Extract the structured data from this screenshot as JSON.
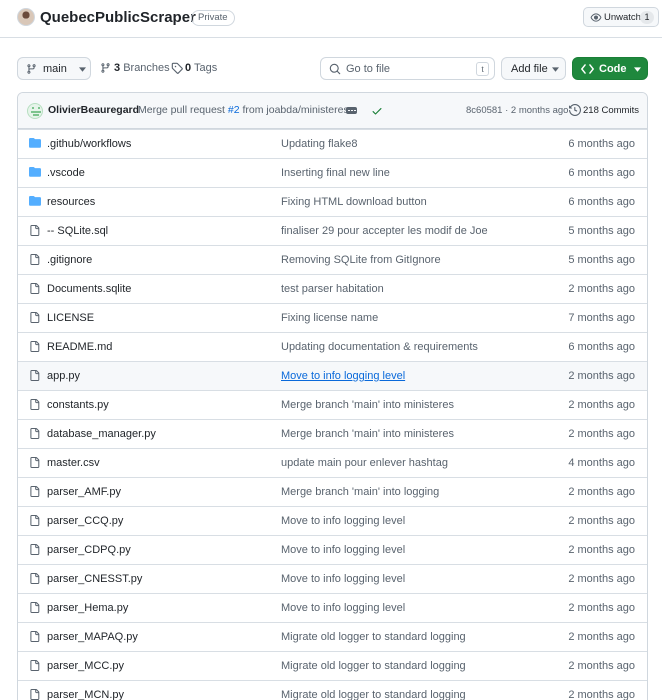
{
  "repo": {
    "name": "QuebecPublicScraper",
    "visibility": "Private",
    "watch_label": "Unwatch",
    "watch_count": "1"
  },
  "toolbar": {
    "branch": "main",
    "branches_count": "3",
    "branches_label": "Branches",
    "tags_count": "0",
    "tags_label": "Tags",
    "goto_placeholder": "Go to file",
    "goto_shortcut": "t",
    "add_file_label": "Add file",
    "code_label": "Code"
  },
  "commit": {
    "author": "OlivierBeauregard",
    "message_prefix": "Merge pull request",
    "pr_number": "#2",
    "message_suffix": "from joabda/ministeres",
    "hash_age": "8c60581 · 2 months ago",
    "commits_label": "218 Commits"
  },
  "colors": {
    "accent_green": "#1f883d",
    "link_blue": "#0969da",
    "folder_blue": "#54aeff",
    "muted": "#59636e"
  },
  "files": [
    {
      "name": ".github/workflows",
      "type": "folder",
      "message": "Updating flake8",
      "age": "6 months ago"
    },
    {
      "name": ".vscode",
      "type": "folder",
      "message": "Inserting final new line",
      "age": "6 months ago"
    },
    {
      "name": "resources",
      "type": "folder",
      "message": "Fixing HTML download button",
      "age": "6 months ago"
    },
    {
      "name": "-- SQLite.sql",
      "type": "file",
      "message": "finaliser 29 pour accepter les modif de Joe",
      "age": "5 months ago"
    },
    {
      "name": ".gitignore",
      "type": "file",
      "message": "Removing SQLite from GitIgnore",
      "age": "5 months ago"
    },
    {
      "name": "Documents.sqlite",
      "type": "file",
      "message": "test parser habitation",
      "age": "2 months ago"
    },
    {
      "name": "LICENSE",
      "type": "file",
      "message": "Fixing license name",
      "age": "7 months ago"
    },
    {
      "name": "README.md",
      "type": "file",
      "message": "Updating documentation & requirements",
      "age": "6 months ago"
    },
    {
      "name": "app.py",
      "type": "file",
      "message": "Move to info logging level",
      "age": "2 months ago",
      "hover": true
    },
    {
      "name": "constants.py",
      "type": "file",
      "message": "Merge branch 'main' into ministeres",
      "age": "2 months ago"
    },
    {
      "name": "database_manager.py",
      "type": "file",
      "message": "Merge branch 'main' into ministeres",
      "age": "2 months ago"
    },
    {
      "name": "master.csv",
      "type": "file",
      "message": "update main pour enlever hashtag",
      "age": "4 months ago"
    },
    {
      "name": "parser_AMF.py",
      "type": "file",
      "message": "Merge branch 'main' into logging",
      "age": "2 months ago"
    },
    {
      "name": "parser_CCQ.py",
      "type": "file",
      "message": "Move to info logging level",
      "age": "2 months ago"
    },
    {
      "name": "parser_CDPQ.py",
      "type": "file",
      "message": "Move to info logging level",
      "age": "2 months ago"
    },
    {
      "name": "parser_CNESST.py",
      "type": "file",
      "message": "Move to info logging level",
      "age": "2 months ago"
    },
    {
      "name": "parser_Hema.py",
      "type": "file",
      "message": "Move to info logging level",
      "age": "2 months ago"
    },
    {
      "name": "parser_MAPAQ.py",
      "type": "file",
      "message": "Migrate old logger to standard logging",
      "age": "2 months ago"
    },
    {
      "name": "parser_MCC.py",
      "type": "file",
      "message": "Migrate old logger to standard logging",
      "age": "2 months ago"
    },
    {
      "name": "parser_MCN.py",
      "type": "file",
      "message": "Migrate old logger to standard logging",
      "age": "2 months ago"
    }
  ]
}
